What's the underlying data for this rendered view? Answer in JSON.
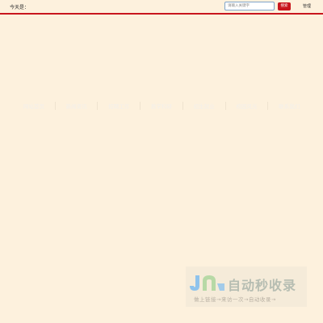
{
  "header": {
    "date_label": "今天是：",
    "search_placeholder": "请输入关键字",
    "search_button": "搜索",
    "manage_link": "管理"
  },
  "nav": {
    "items": [
      "网站首页",
      "新闻资讯",
      "招聘工作",
      "教学科研",
      "招生就业",
      "校园风光",
      "联系我们"
    ]
  },
  "watermark": {
    "logo_text": "JN",
    "title": "自动秒收录",
    "subtitle": "做上链接→来访一次→自动收录→",
    "colors": {
      "logo_blue": "#8fc3ec",
      "logo_green": "#b7d9a6"
    }
  }
}
